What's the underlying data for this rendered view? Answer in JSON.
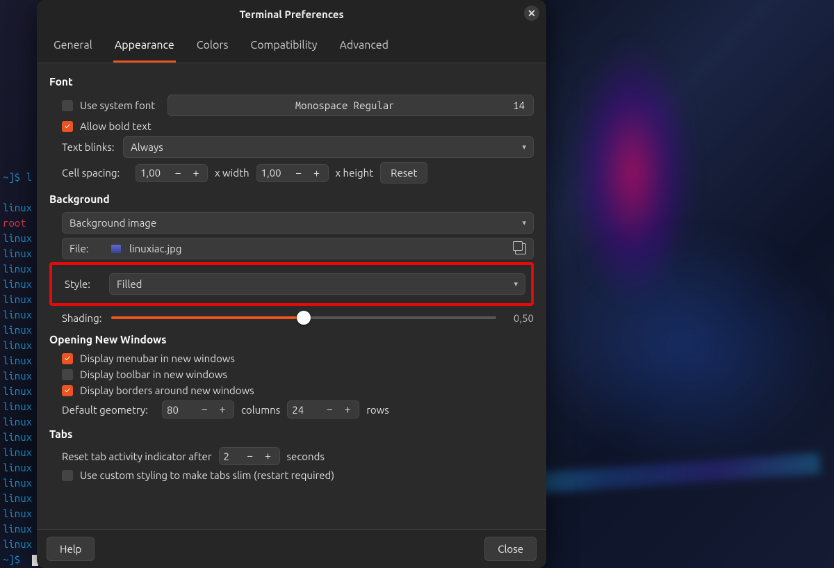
{
  "window": {
    "title": "Terminal Preferences"
  },
  "tabs": [
    {
      "label": "General"
    },
    {
      "label": "Appearance"
    },
    {
      "label": "Colors"
    },
    {
      "label": "Compatibility"
    },
    {
      "label": "Advanced"
    }
  ],
  "font": {
    "section": "Font",
    "use_system_label": "Use system font",
    "font_name": "Monospace Regular",
    "font_size": "14",
    "allow_bold_label": "Allow bold text",
    "text_blinks_label": "Text blinks:",
    "text_blinks_value": "Always",
    "cell_spacing_label": "Cell spacing:",
    "cell_width": "1,00",
    "x_width": "x width",
    "cell_height": "1,00",
    "x_height": "x height",
    "reset": "Reset"
  },
  "background": {
    "section": "Background",
    "mode": "Background image",
    "file_label": "File:",
    "file_name": "linuxiac.jpg",
    "style_label": "Style:",
    "style_value": "Filled",
    "shading_label": "Shading:",
    "shading_value": "0,50",
    "shading_pct": 50
  },
  "opening": {
    "section": "Opening New Windows",
    "menubar_label": "Display menubar in new windows",
    "toolbar_label": "Display toolbar in new windows",
    "borders_label": "Display borders around new windows",
    "geometry_label": "Default geometry:",
    "cols": "80",
    "cols_label": "columns",
    "rows": "24",
    "rows_label": "rows"
  },
  "tabs_section": {
    "section": "Tabs",
    "reset_label_a": "Reset tab activity indicator after",
    "reset_value": "2",
    "reset_label_b": "seconds",
    "slim_label": "Use custom styling to make tabs slim (restart required)"
  },
  "footer": {
    "help": "Help",
    "close": "Close"
  },
  "bg_terminal": {
    "prompt": "~]$ l",
    "word": "linux",
    "root": "root",
    "finalprompt": "~]$ "
  }
}
